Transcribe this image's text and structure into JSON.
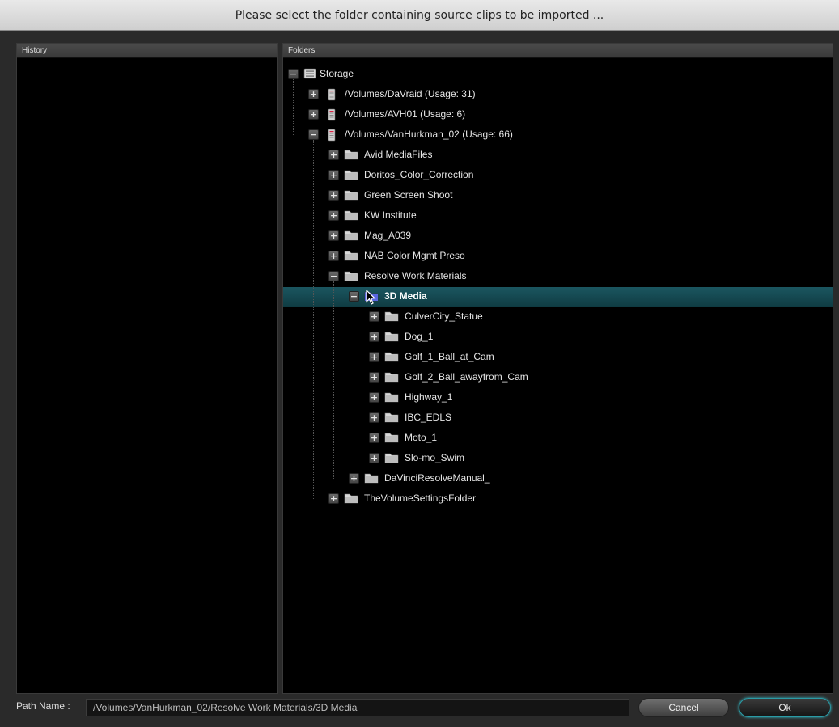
{
  "dialog": {
    "title": "Please select the folder containing source clips to be imported ..."
  },
  "history": {
    "header": "History"
  },
  "folders": {
    "header": "Folders",
    "tree": [
      {
        "label": "Storage",
        "depth": 0,
        "state": "expanded",
        "icon": "storage-icon"
      },
      {
        "label": "/Volumes/DaVraid (Usage: 31)",
        "depth": 1,
        "state": "collapsed",
        "icon": "drive-icon"
      },
      {
        "label": "/Volumes/AVH01 (Usage: 6)",
        "depth": 1,
        "state": "collapsed",
        "icon": "drive-icon"
      },
      {
        "label": "/Volumes/VanHurkman_02 (Usage: 66)",
        "depth": 1,
        "state": "expanded",
        "icon": "drive-icon"
      },
      {
        "label": "Avid MediaFiles",
        "depth": 2,
        "state": "collapsed",
        "icon": "folder-icon"
      },
      {
        "label": "Doritos_Color_Correction",
        "depth": 2,
        "state": "collapsed",
        "icon": "folder-icon"
      },
      {
        "label": "Green Screen Shoot",
        "depth": 2,
        "state": "collapsed",
        "icon": "folder-icon"
      },
      {
        "label": "KW Institute",
        "depth": 2,
        "state": "collapsed",
        "icon": "folder-icon"
      },
      {
        "label": "Mag_A039",
        "depth": 2,
        "state": "collapsed",
        "icon": "folder-icon"
      },
      {
        "label": "NAB Color Mgmt Preso",
        "depth": 2,
        "state": "collapsed",
        "icon": "folder-icon"
      },
      {
        "label": "Resolve Work Materials",
        "depth": 2,
        "state": "expanded",
        "icon": "folder-icon"
      },
      {
        "label": "3D Media",
        "depth": 3,
        "state": "expanded",
        "icon": "folder-icon",
        "selected": true
      },
      {
        "label": "CulverCity_Statue",
        "depth": 4,
        "state": "collapsed",
        "icon": "folder-icon"
      },
      {
        "label": "Dog_1",
        "depth": 4,
        "state": "collapsed",
        "icon": "folder-icon"
      },
      {
        "label": "Golf_1_Ball_at_Cam",
        "depth": 4,
        "state": "collapsed",
        "icon": "folder-icon"
      },
      {
        "label": "Golf_2_Ball_awayfrom_Cam",
        "depth": 4,
        "state": "collapsed",
        "icon": "folder-icon"
      },
      {
        "label": "Highway_1",
        "depth": 4,
        "state": "collapsed",
        "icon": "folder-icon"
      },
      {
        "label": "IBC_EDLS",
        "depth": 4,
        "state": "collapsed",
        "icon": "folder-icon"
      },
      {
        "label": "Moto_1",
        "depth": 4,
        "state": "collapsed",
        "icon": "folder-icon"
      },
      {
        "label": "Slo-mo_Swim",
        "depth": 4,
        "state": "collapsed",
        "icon": "folder-icon"
      },
      {
        "label": "DaVinciResolveManual_",
        "depth": 3,
        "state": "collapsed",
        "icon": "folder-icon"
      },
      {
        "label": "TheVolumeSettingsFolder",
        "depth": 2,
        "state": "collapsed",
        "icon": "folder-icon"
      }
    ]
  },
  "footer": {
    "path_label": "Path Name :",
    "path_value": "/Volumes/VanHurkman_02/Resolve Work Materials/3D Media",
    "cancel_label": "Cancel",
    "ok_label": "Ok"
  },
  "colors": {
    "selection": "#1b5660",
    "ok_ring": "#38c0cc"
  }
}
